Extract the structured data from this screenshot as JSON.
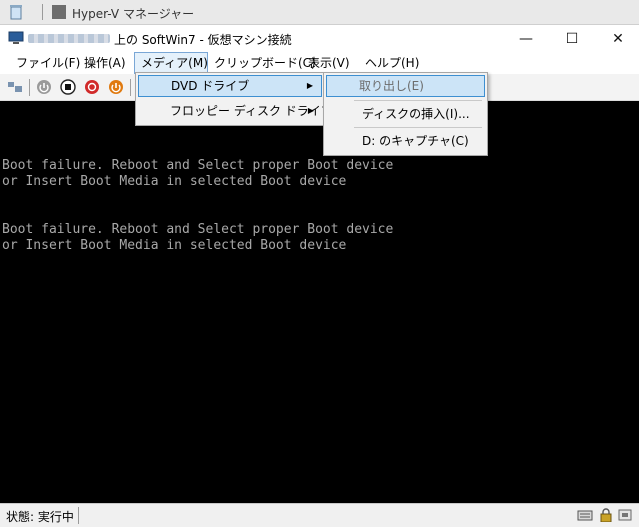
{
  "background_window": {
    "title": "Hyper-V マネージャー"
  },
  "window": {
    "title_suffix": "上の SoftWin7 - 仮想マシン接続",
    "controls": {
      "minimize": "—",
      "maximize": "☐",
      "close": "✕"
    }
  },
  "menubar": [
    {
      "label": "ファイル(F)"
    },
    {
      "label": "操作(A)"
    },
    {
      "label": "メディア(M)"
    },
    {
      "label": "クリップボード(C)"
    },
    {
      "label": "表示(V)"
    },
    {
      "label": "ヘルプ(H)"
    }
  ],
  "media_menu": [
    {
      "label": "DVD ドライブ",
      "arrow": "▶"
    },
    {
      "label": "フロッピー ディスク ドライブ",
      "arrow": "▶"
    }
  ],
  "dvd_submenu": [
    {
      "label": "取り出し(E)"
    },
    {
      "label": "ディスクの挿入(I)..."
    },
    {
      "label": "D: のキャプチャ(C)"
    }
  ],
  "console_lines": [
    "Boot failure. Reboot and Select proper Boot device",
    "or Insert Boot Media in selected Boot device",
    "",
    "",
    "Boot failure. Reboot and Select proper Boot device",
    "or Insert Boot Media in selected Boot device"
  ],
  "status": {
    "text": "状態: 実行中"
  },
  "icons": {
    "toolbar": [
      "ctrl-alt-del-icon",
      "start-icon",
      "turn-off-icon",
      "shutdown-icon",
      "save-icon",
      "pause-icon"
    ],
    "status": [
      "keyboard-icon",
      "lock-icon",
      "network-icon"
    ]
  },
  "colors": {
    "console_bg": "#000000",
    "console_text": "#a8a8a8",
    "menu_highlight": "#cce4f7"
  }
}
